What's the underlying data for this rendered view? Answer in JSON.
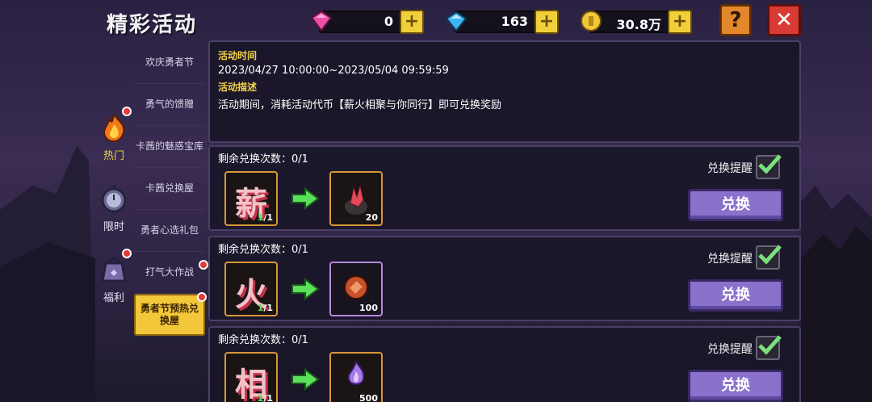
{
  "header": {
    "title": "精彩活动"
  },
  "currencies": [
    {
      "icon": "pink-gem-icon",
      "value": "0"
    },
    {
      "icon": "blue-diamond-icon",
      "value": "163"
    },
    {
      "icon": "gold-coin-icon",
      "value": "30.8万"
    }
  ],
  "buttons": {
    "help": "?",
    "close": "✕",
    "plus": "+"
  },
  "categories": [
    {
      "label": "热门",
      "icon": "flame-icon"
    },
    {
      "label": "限时",
      "icon": "stopwatch-icon"
    },
    {
      "label": "福利",
      "icon": "gift-bag-icon"
    }
  ],
  "submenu": [
    {
      "label": "欢庆勇者节"
    },
    {
      "label": "勇气的馈赠"
    },
    {
      "label": "卡茜的魅惑宝库"
    },
    {
      "label": "卡茜兑换屋"
    },
    {
      "label": "勇者心选礼包"
    },
    {
      "label": "打气大作战"
    },
    {
      "label": "勇者节预热兑换屋"
    }
  ],
  "info": {
    "time_heading": "活动时间",
    "time_value": "2023/04/27 10:00:00~2023/05/04 09:59:59",
    "desc_heading": "活动描述",
    "desc_value": "活动期间，消耗活动代币【薪火相聚与你同行】即可兑换奖励"
  },
  "exchanges": [
    {
      "remaining": "剩余兑换次数：0/1",
      "token": "薪",
      "token_count_have": "1",
      "token_count_need": "/1",
      "reward_icon": "crystal-ore-icon",
      "reward_count": "20",
      "remind_label": "兑换提醒",
      "button_label": "兑换"
    },
    {
      "remaining": "剩余兑换次数：0/1",
      "token": "火",
      "token_count_have": "1",
      "token_count_need": "/1",
      "reward_icon": "copper-coin-icon",
      "reward_count": "100",
      "remind_label": "兑换提醒",
      "button_label": "兑换"
    },
    {
      "remaining": "剩余兑换次数：0/1",
      "token": "相",
      "token_count_have": "1",
      "token_count_need": "/1",
      "reward_icon": "purple-flame-icon",
      "reward_count": "500",
      "remind_label": "兑换提醒",
      "button_label": "兑换"
    }
  ],
  "colors": {
    "accent_gold": "#f2c73a",
    "button_purple": "#8a72cc",
    "close_red": "#d93a34",
    "help_orange": "#e2872c"
  }
}
